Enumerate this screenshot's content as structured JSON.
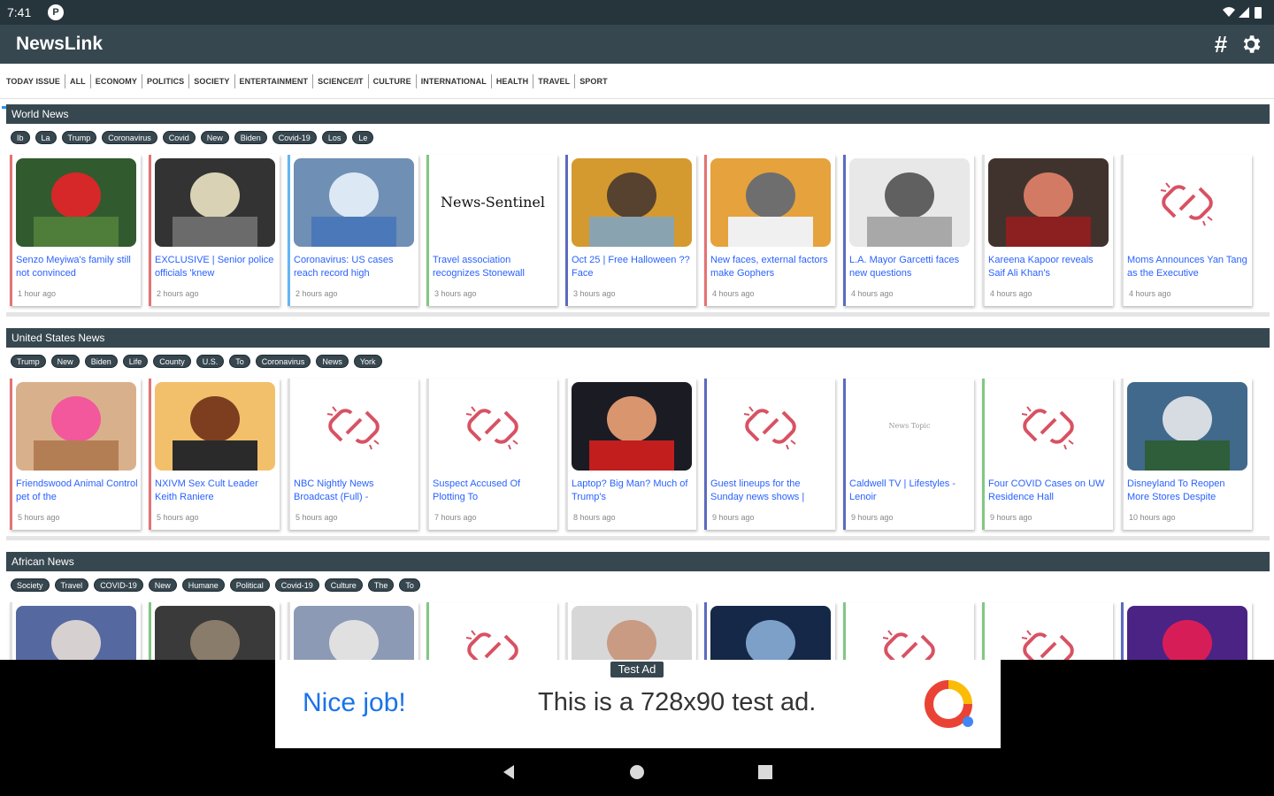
{
  "status": {
    "time": "7:41",
    "app_icon": "P"
  },
  "app": {
    "title": "NewsLink",
    "hashtag_icon": "#"
  },
  "tabs": [
    "TODAY ISSUE",
    "ALL",
    "ECONOMY",
    "POLITICS",
    "SOCIETY",
    "ENTERTAINMENT",
    "SCIENCE/IT",
    "CULTURE",
    "INTERNATIONAL",
    "HEALTH",
    "TRAVEL",
    "SPORT"
  ],
  "sections": [
    {
      "title": "World News",
      "tags": [
        "Ib",
        "La",
        "Trump",
        "Coronavirus",
        "Covid",
        "New",
        "Biden",
        "Covid-19",
        "Los",
        "Le"
      ],
      "cards": [
        {
          "title": "Senzo Meyiwa's family still not convinced",
          "time": "1 hour ago",
          "color": "#e57373",
          "image": "photo-green"
        },
        {
          "title": "EXCLUSIVE | Senior police officials 'knew",
          "time": "2 hours ago",
          "color": "#e57373",
          "image": "photo-dark"
        },
        {
          "title": "Coronavirus: US cases reach record high",
          "time": "2 hours ago",
          "color": "#64b5f6",
          "image": "photo-blue"
        },
        {
          "title": "Travel association recognizes Stonewall",
          "time": "3 hours ago",
          "color": "#81c784",
          "image": "masthead"
        },
        {
          "title": "Oct 25 | Free Halloween ?? Face",
          "time": "3 hours ago",
          "color": "#5c6bc0",
          "image": "photo-collage"
        },
        {
          "title": "New faces, external factors make Gophers",
          "time": "4 hours ago",
          "color": "#e57373",
          "image": "photo-orange"
        },
        {
          "title": "L.A. Mayor Garcetti faces new questions",
          "time": "4 hours ago",
          "color": "#5c6bc0",
          "image": "photo-building"
        },
        {
          "title": "Kareena Kapoor reveals Saif Ali Khan's",
          "time": "4 hours ago",
          "color": "#e0e0e0",
          "image": "photo-couple"
        },
        {
          "title": "Moms Announces Yan Tang as the Executive",
          "time": "4 hours ago",
          "color": "#e0e0e0",
          "image": "broken-link"
        }
      ]
    },
    {
      "title": "United States News",
      "tags": [
        "Trump",
        "New",
        "Biden",
        "Life",
        "County",
        "U.S.",
        "To",
        "Coronavirus",
        "News",
        "York"
      ],
      "cards": [
        {
          "title": "Friendswood Animal Control pet of the",
          "time": "5 hours ago",
          "color": "#e57373",
          "image": "photo-dog"
        },
        {
          "title": "NXIVM Sex Cult Leader Keith Raniere",
          "time": "5 hours ago",
          "color": "#e57373",
          "image": "photo-court"
        },
        {
          "title": "NBC Nightly News Broadcast (Full) -",
          "time": "5 hours ago",
          "color": "#e0e0e0",
          "image": "broken-link"
        },
        {
          "title": "Suspect Accused Of Plotting To",
          "time": "7 hours ago",
          "color": "#e0e0e0",
          "image": "broken-link"
        },
        {
          "title": "Laptop? Big Man? Much of Trump's",
          "time": "8 hours ago",
          "color": "#e0e0e0",
          "image": "photo-trump"
        },
        {
          "title": "Guest lineups for the Sunday news shows |",
          "time": "9 hours ago",
          "color": "#5c6bc0",
          "image": "broken-link"
        },
        {
          "title": "Caldwell TV | Lifestyles - Lenoir",
          "time": "9 hours ago",
          "color": "#5c6bc0",
          "image": "blank-text"
        },
        {
          "title": "Four COVID Cases on UW Residence Hall",
          "time": "9 hours ago",
          "color": "#81c784",
          "image": "broken-link"
        },
        {
          "title": "Disneyland To Reopen More Stores Despite",
          "time": "10 hours ago",
          "color": "#e0e0e0",
          "image": "photo-park"
        }
      ]
    },
    {
      "title": "African News",
      "tags": [
        "Society",
        "Travel",
        "COVID-19",
        "New",
        "Humane",
        "Political",
        "Covid-19",
        "Culture",
        "The",
        "To"
      ],
      "cards": [
        {
          "title": "",
          "time": "",
          "color": "#e0e0e0",
          "image": "photo-man"
        },
        {
          "title": "",
          "time": "",
          "color": "#81c784",
          "image": "photo-crowd"
        },
        {
          "title": "",
          "time": "",
          "color": "#e0e0e0",
          "image": "photo-mask"
        },
        {
          "title": "",
          "time": "",
          "color": "#81c784",
          "image": "broken-link"
        },
        {
          "title": "",
          "time": "",
          "color": "#e0e0e0",
          "image": "photo-vaccine"
        },
        {
          "title": "",
          "time": "",
          "color": "#5c6bc0",
          "image": "photo-night"
        },
        {
          "title": "",
          "time": "",
          "color": "#81c784",
          "image": "broken-link"
        },
        {
          "title": "",
          "time": "",
          "color": "#81c784",
          "image": "broken-link"
        },
        {
          "title": "",
          "time": "",
          "color": "#5c6bc0",
          "image": "photo-501"
        }
      ]
    }
  ],
  "ad": {
    "label": "Test Ad",
    "headline": "Nice job!",
    "text": "This is a 728x90 test ad.",
    "icon": "ad-logo-icon"
  },
  "colors": {
    "app_bar": "#37474f",
    "accent": "#2196f3",
    "link": "#2962ff"
  }
}
